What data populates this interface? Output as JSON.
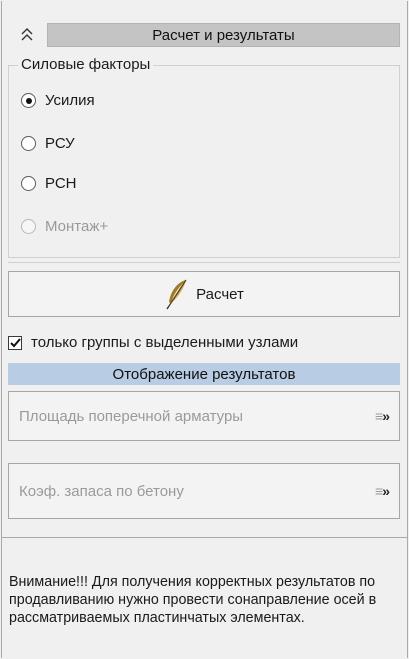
{
  "header": {
    "collapse_icon": "double-chevron-up-icon",
    "title": "Расчет и результаты"
  },
  "force_factors": {
    "legend": "Силовые факторы",
    "options": [
      {
        "label": "Усилия",
        "selected": true,
        "enabled": true
      },
      {
        "label": "РСУ",
        "selected": false,
        "enabled": true
      },
      {
        "label": "РСН",
        "selected": false,
        "enabled": true
      },
      {
        "label": "Монтаж+",
        "selected": false,
        "enabled": false
      }
    ]
  },
  "calc_button": {
    "icon": "feather-icon",
    "label": "Расчет"
  },
  "only_selected_nodes": {
    "label": "только группы с выделенными узлами",
    "checked": true
  },
  "results_bar": {
    "label": "Отображение результатов",
    "color": "#b8cce4"
  },
  "result_buttons": [
    {
      "label": "Площадь поперечной арматуры",
      "icon": "expand-arrows-icon",
      "enabled": false
    },
    {
      "label": "Коэф. запаса по бетону",
      "icon": "expand-arrows-icon",
      "enabled": false
    }
  ],
  "note": {
    "text": "Внимание!!! Для получения корректных результатов по продавливанию нужно провести сонаправление осей в рассматриваемых пластинчатых элементах."
  }
}
